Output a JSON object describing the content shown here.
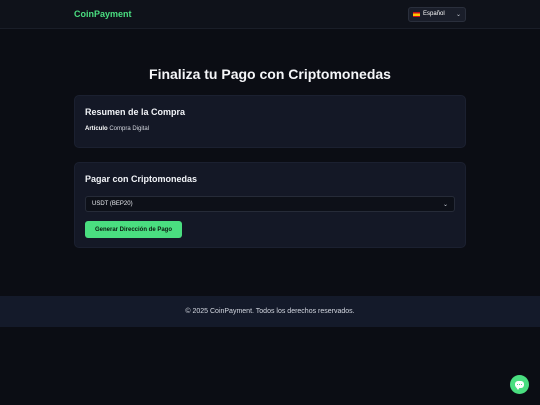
{
  "header": {
    "brand": "CoinPayment",
    "language": {
      "selected": "Español",
      "flag_icon": "spain-flag-icon"
    }
  },
  "main": {
    "title": "Finaliza tu Pago con Criptomonedas",
    "summary_card": {
      "title": "Resumen de la Compra",
      "item_label": "Artículo",
      "item_value": "Compra Digital"
    },
    "payment_card": {
      "title": "Pagar con Criptomonedas",
      "currency_selected": "USDT (BEP20)",
      "generate_button": "Generar Dirección de Pago"
    }
  },
  "footer": {
    "text": "© 2025 CoinPayment. Todos los derechos reservados."
  },
  "colors": {
    "accent": "#4ade80",
    "background": "#0b0d14",
    "card": "#141826"
  },
  "chat": {
    "icon": "chat-bubble-icon"
  }
}
